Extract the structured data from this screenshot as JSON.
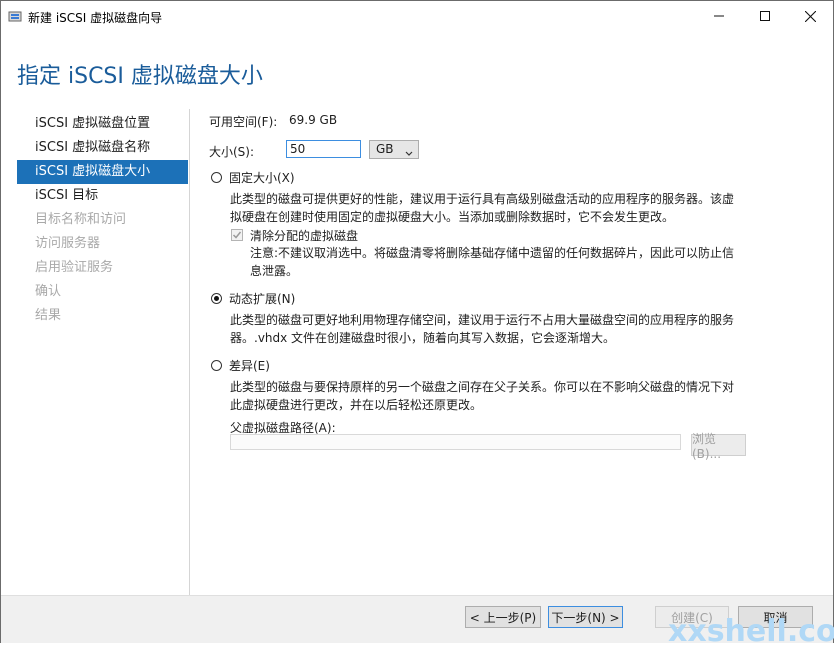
{
  "window": {
    "title": "新建 iSCSI 虚拟磁盘向导"
  },
  "header": {
    "title": "指定 iSCSI 虚拟磁盘大小"
  },
  "nav": {
    "items": [
      {
        "label": "iSCSI 虚拟磁盘位置"
      },
      {
        "label": "iSCSI 虚拟磁盘名称"
      },
      {
        "label": "iSCSI 虚拟磁盘大小"
      },
      {
        "label": "iSCSI 目标"
      },
      {
        "label": "目标名称和访问"
      },
      {
        "label": "访问服务器"
      },
      {
        "label": "启用验证服务"
      },
      {
        "label": "确认"
      },
      {
        "label": "结果"
      }
    ]
  },
  "main": {
    "free_space_label": "可用空间(F):",
    "free_space_value": "69.9 GB",
    "size_label": "大小(S):",
    "size_value": "50",
    "unit_value": "GB",
    "fixed": {
      "label": "固定大小(X)",
      "desc_line1": "此类型的磁盘可提供更好的性能，建议用于运行具有高级别磁盘活动的应用程序的服务器。该虚",
      "desc_line2": "拟硬盘在创建时使用固定的虚拟硬盘大小。当添加或删除数据时，它不会发生更改。",
      "clear_label": "清除分配的虚拟磁盘",
      "note_line1": "注意:不建议取消选中。将磁盘清零将删除基础存储中遗留的任何数据碎片，因此可以防止信",
      "note_line2": "息泄露。"
    },
    "dynamic": {
      "label": "动态扩展(N)",
      "desc_line1": "此类型的磁盘可更好地利用物理存储空间，建议用于运行不占用大量磁盘空间的应用程序的服务",
      "desc_line2": "器。.vhdx 文件在创建磁盘时很小，随着向其写入数据，它会逐渐增大。"
    },
    "diff": {
      "label": "差异(E)",
      "desc_line1": "此类型的磁盘与要保持原样的另一个磁盘之间存在父子关系。你可以在不影响父磁盘的情况下对",
      "desc_line2": "此虚拟硬盘进行更改，并在以后轻松还原更改。",
      "parent_label": "父虚拟磁盘路径(A):",
      "parent_value": "",
      "browse_label": "浏览(B)..."
    }
  },
  "footer": {
    "prev_label": "< 上一步(P)",
    "next_label": "下一步(N) >",
    "create_label": "创建(C)",
    "cancel_label": "取消"
  },
  "watermark": "xxshell.com",
  "colors": {
    "accent": "#1c71b8",
    "header": "#1a5c9a"
  }
}
